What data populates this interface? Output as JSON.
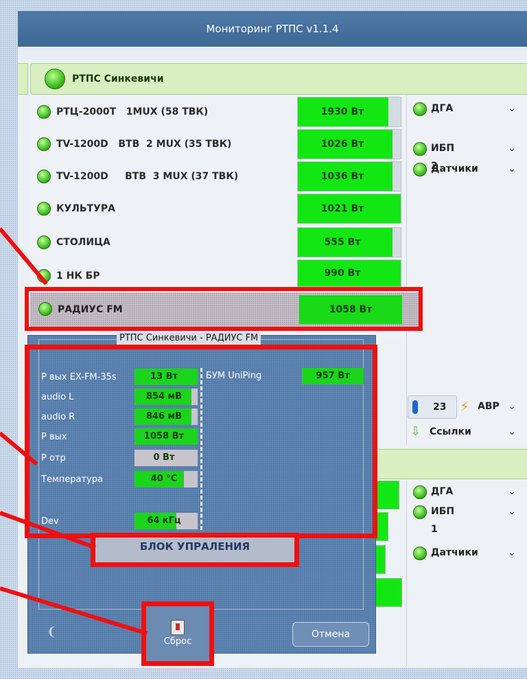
{
  "window": {
    "title": "Мониторинг РТПС v1.1.4"
  },
  "station": {
    "name": "РТПС Синкевичи"
  },
  "transmitters": [
    {
      "label": "РТЦ-2000Т   1MUX (58 ТВК)",
      "power": "1930 Вт",
      "level": 0.88
    },
    {
      "label": "TV-1200D   ВТВ  2 MUX (35 ТВК)",
      "power": "1026 Вт",
      "level": 0.92
    },
    {
      "label": "TV-1200D     ВТВ  3 MUX (37 ТВК)",
      "power": "1036 Вт",
      "level": 0.92
    },
    {
      "label": "КУЛЬТУРА",
      "power": "1021 Вт",
      "level": 1.0
    },
    {
      "label": "СТОЛИЦА",
      "power": "555 Вт",
      "level": 0.92
    },
    {
      "label": "1 НК БР",
      "power": "990 Вт",
      "level": 1.0
    }
  ],
  "highlighted_row": {
    "label": "РАДИУС FM",
    "power": "1058 Вт",
    "level": 0.87
  },
  "right_panel": {
    "items": [
      {
        "label": "ДГА"
      },
      {
        "label": "ИБП 2"
      },
      {
        "label": "Датчики"
      }
    ],
    "temperature": "23",
    "avr_label": "АВР",
    "links_label": "Ссылки"
  },
  "right_panel2": {
    "items": [
      {
        "label": "ДГА"
      },
      {
        "label": "ИБП 1"
      },
      {
        "label": "Датчики"
      }
    ]
  },
  "dialog": {
    "title": "РТПС Синкевичи - РАДИУС FM",
    "params": [
      {
        "label": "P вых EX-FM-35s",
        "value": "13 Вт",
        "level": 1.0
      },
      {
        "label": "audio L",
        "value": "854 мВ",
        "level": 0.9
      },
      {
        "label": "audio R",
        "value": "846 мВ",
        "level": 0.9
      },
      {
        "label": "P вых",
        "value": "1058 Вт",
        "level": 1.0
      },
      {
        "label": "P отр",
        "value": "0 Вт",
        "level": 0.0
      },
      {
        "label": "Температура",
        "value": "40 °C",
        "level": 0.78
      },
      {
        "label": "Dev",
        "value": "64 кГц",
        "level": 0.66
      }
    ],
    "bum": {
      "label": "БУМ UniPing",
      "value": "957 Вт"
    },
    "block_button": "БЛОК УПРАЛЕНИЯ",
    "reset_button": "Сброс",
    "cancel_button": "Отмена"
  },
  "colors": {
    "ok_green": "#13e713",
    "highlight_red": "#ee1010",
    "title_blue": "#4f79a8"
  }
}
